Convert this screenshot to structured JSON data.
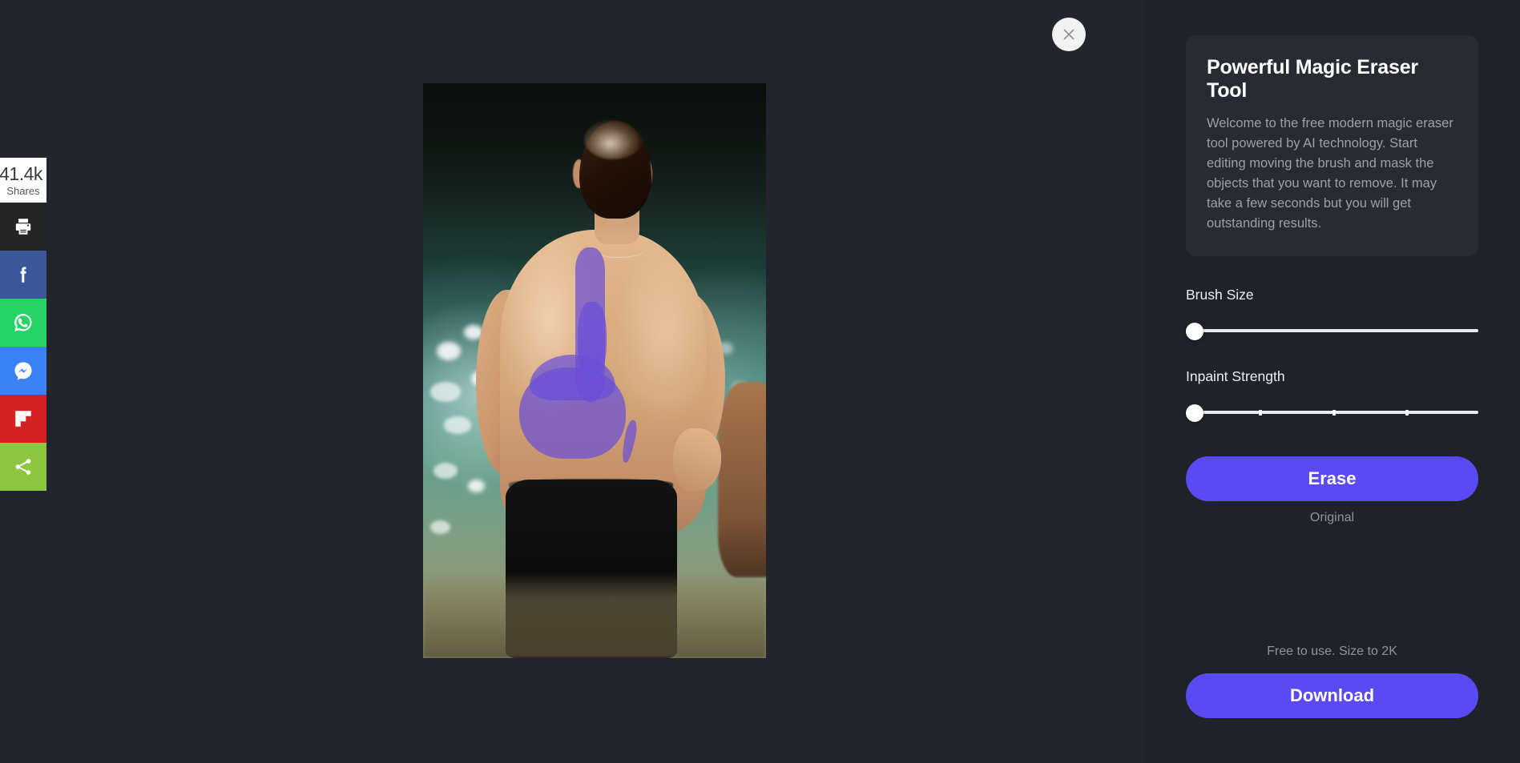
{
  "share_rail": {
    "count": "41.4k",
    "count_label": "Shares",
    "buttons": [
      {
        "name": "print",
        "icon": "print-icon",
        "color": "#252525"
      },
      {
        "name": "facebook",
        "icon": "facebook-icon",
        "color": "#3b5998"
      },
      {
        "name": "whatsapp",
        "icon": "whatsapp-icon",
        "color": "#25d366"
      },
      {
        "name": "messenger",
        "icon": "messenger-icon",
        "color": "#3b82f6"
      },
      {
        "name": "flipboard",
        "icon": "flipboard-icon",
        "color": "#d52121"
      },
      {
        "name": "share",
        "icon": "share-icon",
        "color": "#8dc63f"
      }
    ]
  },
  "editor": {
    "close_icon": "close-icon",
    "canvas": {
      "image_alt": "Back view of a shirtless man standing in water with a spine tattoo and a lower-back tattoo",
      "mask_color": "#6a4fd8",
      "mask_opacity": 0.72
    }
  },
  "sidebar": {
    "info": {
      "title": "Powerful Magic Eraser Tool",
      "body": "Welcome to the free modern magic eraser tool powered by AI technology. Start editing moving the brush and mask the objects that you want to remove. It may take a few seconds but you will get outstanding results."
    },
    "controls": [
      {
        "label": "Brush Size",
        "value_percent": 0,
        "ticks": []
      },
      {
        "label": "Inpaint Strength",
        "value_percent": 0,
        "ticks": [
          25,
          50,
          75
        ]
      }
    ],
    "brush_size_label": "Brush Size",
    "inpaint_strength_label": "Inpaint Strength",
    "erase_label": "Erase",
    "original_label": "Original",
    "free_note": "Free to use. Size to 2K",
    "download_label": "Download",
    "accent_color": "#5a4af4"
  }
}
